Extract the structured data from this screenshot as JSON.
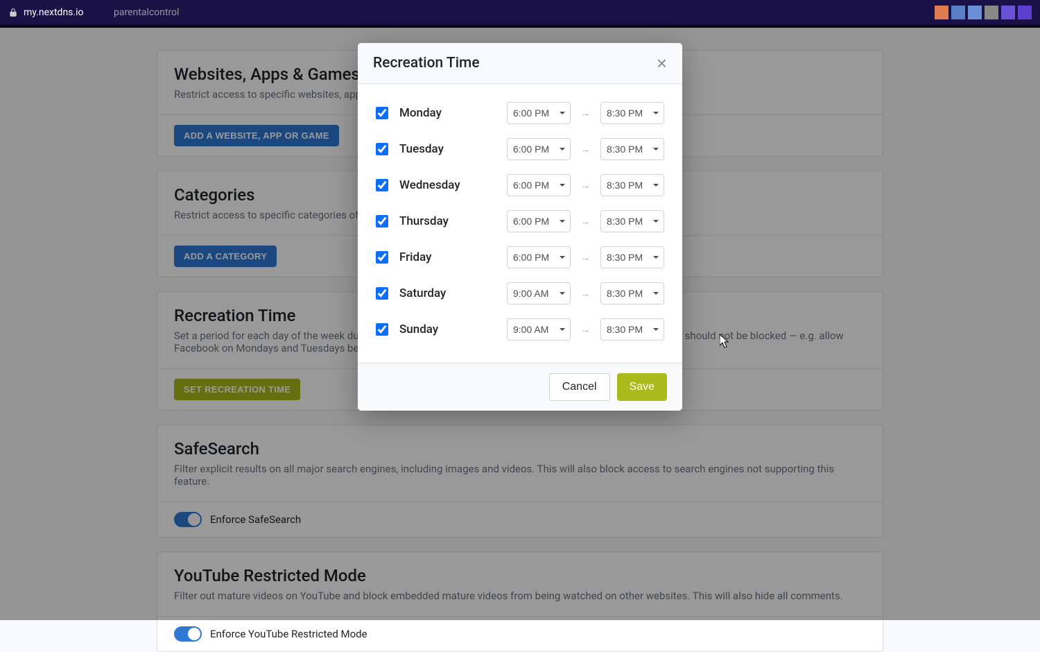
{
  "addressbar": {
    "host": "my.nextdns.io",
    "path": "parentalcontrol"
  },
  "sections": {
    "websites": {
      "title": "Websites, Apps & Games",
      "desc": "Restrict access to specific websites, apps and games.",
      "button": "ADD A WEBSITE, APP OR GAME"
    },
    "categories": {
      "title": "Categories",
      "desc": "Restrict access to specific categories of websites and apps.",
      "button": "ADD A CATEGORY"
    },
    "recreation": {
      "title": "Recreation Time",
      "desc": "Set a period for each day of the week during which some of the websites, apps, games or categories set above should not be blocked — e.g. allow Facebook on Mondays and Tuesdays between 6pm and 8pm.",
      "button": "SET RECREATION TIME"
    },
    "safesearch": {
      "title": "SafeSearch",
      "desc": "Filter explicit results on all major search engines, including images and videos. This will also block access to search engines not supporting this feature.",
      "toggle_label": "Enforce SafeSearch",
      "toggle_on": true
    },
    "youtube": {
      "title": "YouTube Restricted Mode",
      "desc": "Filter out mature videos on YouTube and block embedded mature videos from being watched on other websites. This will also hide all comments.",
      "toggle_label": "Enforce YouTube Restricted Mode",
      "toggle_on": true
    }
  },
  "modal": {
    "title": "Recreation Time",
    "days": [
      {
        "label": "Monday",
        "checked": true,
        "start": "6:00 PM",
        "end": "8:30 PM"
      },
      {
        "label": "Tuesday",
        "checked": true,
        "start": "6:00 PM",
        "end": "8:30 PM"
      },
      {
        "label": "Wednesday",
        "checked": true,
        "start": "6:00 PM",
        "end": "8:30 PM"
      },
      {
        "label": "Thursday",
        "checked": true,
        "start": "6:00 PM",
        "end": "8:30 PM"
      },
      {
        "label": "Friday",
        "checked": true,
        "start": "6:00 PM",
        "end": "8:30 PM"
      },
      {
        "label": "Saturday",
        "checked": true,
        "start": "9:00 AM",
        "end": "8:30 PM"
      },
      {
        "label": "Sunday",
        "checked": true,
        "start": "9:00 AM",
        "end": "8:30 PM"
      }
    ],
    "arrow": "→",
    "cancel": "Cancel",
    "save": "Save"
  }
}
